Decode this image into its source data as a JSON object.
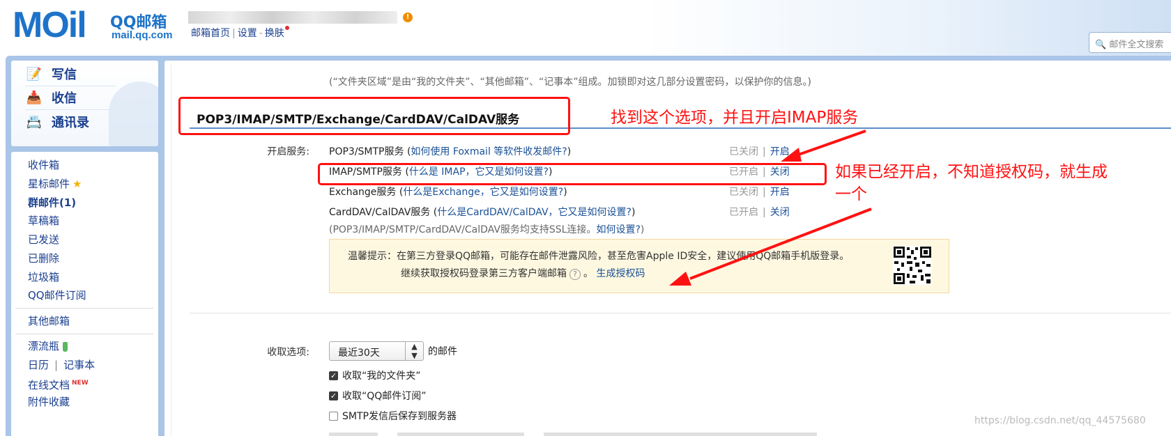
{
  "brand": {
    "logo_text": "MOil",
    "qq_text": "QQ邮箱",
    "domain": "mail.qq.com"
  },
  "top_nav": {
    "home": "邮箱首页",
    "settings": "设置",
    "skin": "换肤"
  },
  "search": {
    "placeholder": "邮件全文搜索"
  },
  "quick_actions": [
    {
      "label": "写信",
      "icon": "write-icon"
    },
    {
      "label": "收信",
      "icon": "inbox-download-icon"
    },
    {
      "label": "通讯录",
      "icon": "contacts-icon"
    }
  ],
  "folders": {
    "inbox": "收件箱",
    "starred": "星标邮件",
    "group": "群邮件(1)",
    "drafts": "草稿箱",
    "sent": "已发送",
    "deleted": "已删除",
    "spam": "垃圾箱",
    "subscription": "QQ邮件订阅",
    "other": "其他邮箱",
    "bottle": "漂流瓶",
    "calendar": "日历",
    "notes": "记事本",
    "docs": "在线文档",
    "docs_badge": "NEW",
    "attachments": "附件收藏"
  },
  "main": {
    "top_note": "(“文件夹区域”是由“我的文件夹”、“其他邮箱”、“记事本”组成。加锁即对这几部分设置密码，以保护你的信息。)",
    "section_title": "POP3/IMAP/SMTP/Exchange/CardDAV/CalDAV服务",
    "services_label": "开启服务:",
    "services": [
      {
        "name": "POP3/SMTP服务",
        "help": "如何使用 Foxmail 等软件收发邮件?",
        "status": "已关闭",
        "action": "开启"
      },
      {
        "name": "IMAP/SMTP服务",
        "help": "什么是 IMAP，它又是如何设置?",
        "status": "已开启",
        "action": "关闭"
      },
      {
        "name": "Exchange服务",
        "help": "什么是Exchange，它又是如何设置?",
        "status": "已关闭",
        "action": "开启"
      },
      {
        "name": "CardDAV/CalDAV服务",
        "help": "什么是CardDAV/CalDAV，它又是如何设置?",
        "status": "已开启",
        "action": "关闭"
      }
    ],
    "ssl_note_prefix": "(POP3/IMAP/SMTP/CardDAV/CalDAV服务均支持SSL连接。",
    "ssl_note_link": "如何设置?",
    "ssl_note_suffix": ")",
    "tip_line1": "温馨提示：在第三方登录QQ邮箱，可能存在邮件泄露风险，甚至危害Apple ID安全，建议使用QQ邮箱手机版登录。",
    "tip_line2": "继续获取授权码登录第三方客户端邮箱",
    "tip_help_glyph": "?",
    "tip_period": "。",
    "tip_link": "生成授权码",
    "receive_label": "收取选项:",
    "receive_select": "最近30天",
    "receive_suffix": "的邮件",
    "checkboxes": [
      {
        "label": "收取“我的文件夹”",
        "checked": true
      },
      {
        "label": "收取“QQ邮件订阅”",
        "checked": true
      },
      {
        "label": "SMTP发信后保存到服务器",
        "checked": false
      }
    ]
  },
  "annotations": {
    "find_option": "找到这个选项，并且开启IMAP服务",
    "generate_line1": "如果已经开启，不知道授权码，就生成",
    "generate_line2": "一个",
    "color": "#ff1111"
  },
  "watermark": "https://blog.csdn.net/qq_44575680"
}
